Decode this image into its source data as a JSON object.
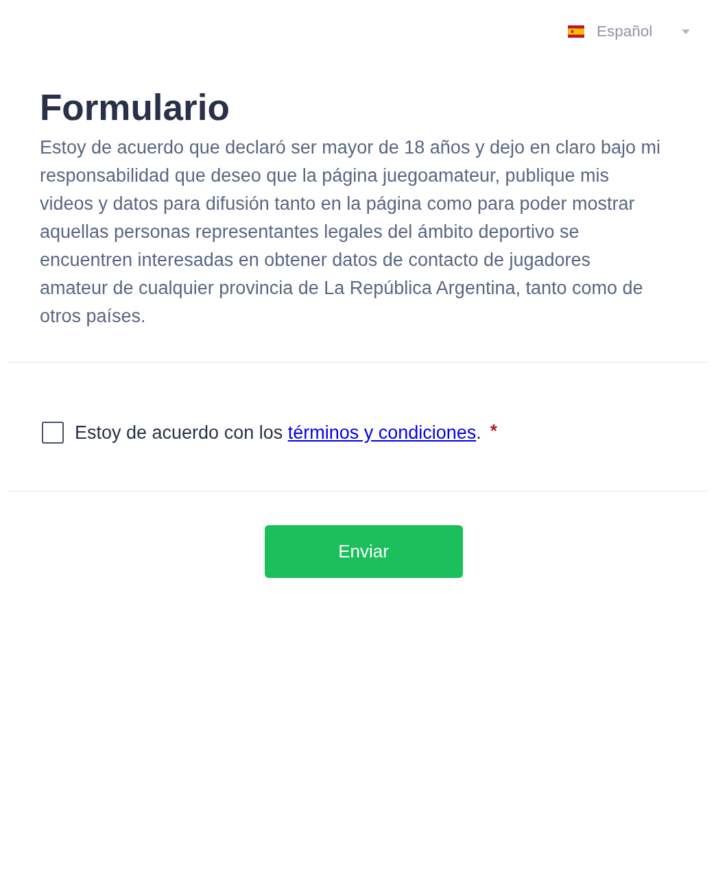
{
  "language_selector": {
    "label": "Español"
  },
  "form": {
    "title": "Formulario",
    "description": "Estoy de acuerdo que declaró ser mayor de 18 años y dejo en claro bajo mi responsabilidad que deseo que la página juegoamateur, publique mis videos y datos para difusión tanto en la página como para poder mostrar aquellas personas representantes legales del ámbito deportivo se encuentren interesadas en obtener datos de contacto de jugadores amateur de cualquier provincia de La República Argentina, tanto como de otros países.",
    "consent": {
      "checked": false,
      "text_before": "Estoy de acuerdo con los",
      "link": "términos y condiciones",
      "text_after": ".",
      "required_mark": "*"
    },
    "submit_button": "Enviar"
  }
}
